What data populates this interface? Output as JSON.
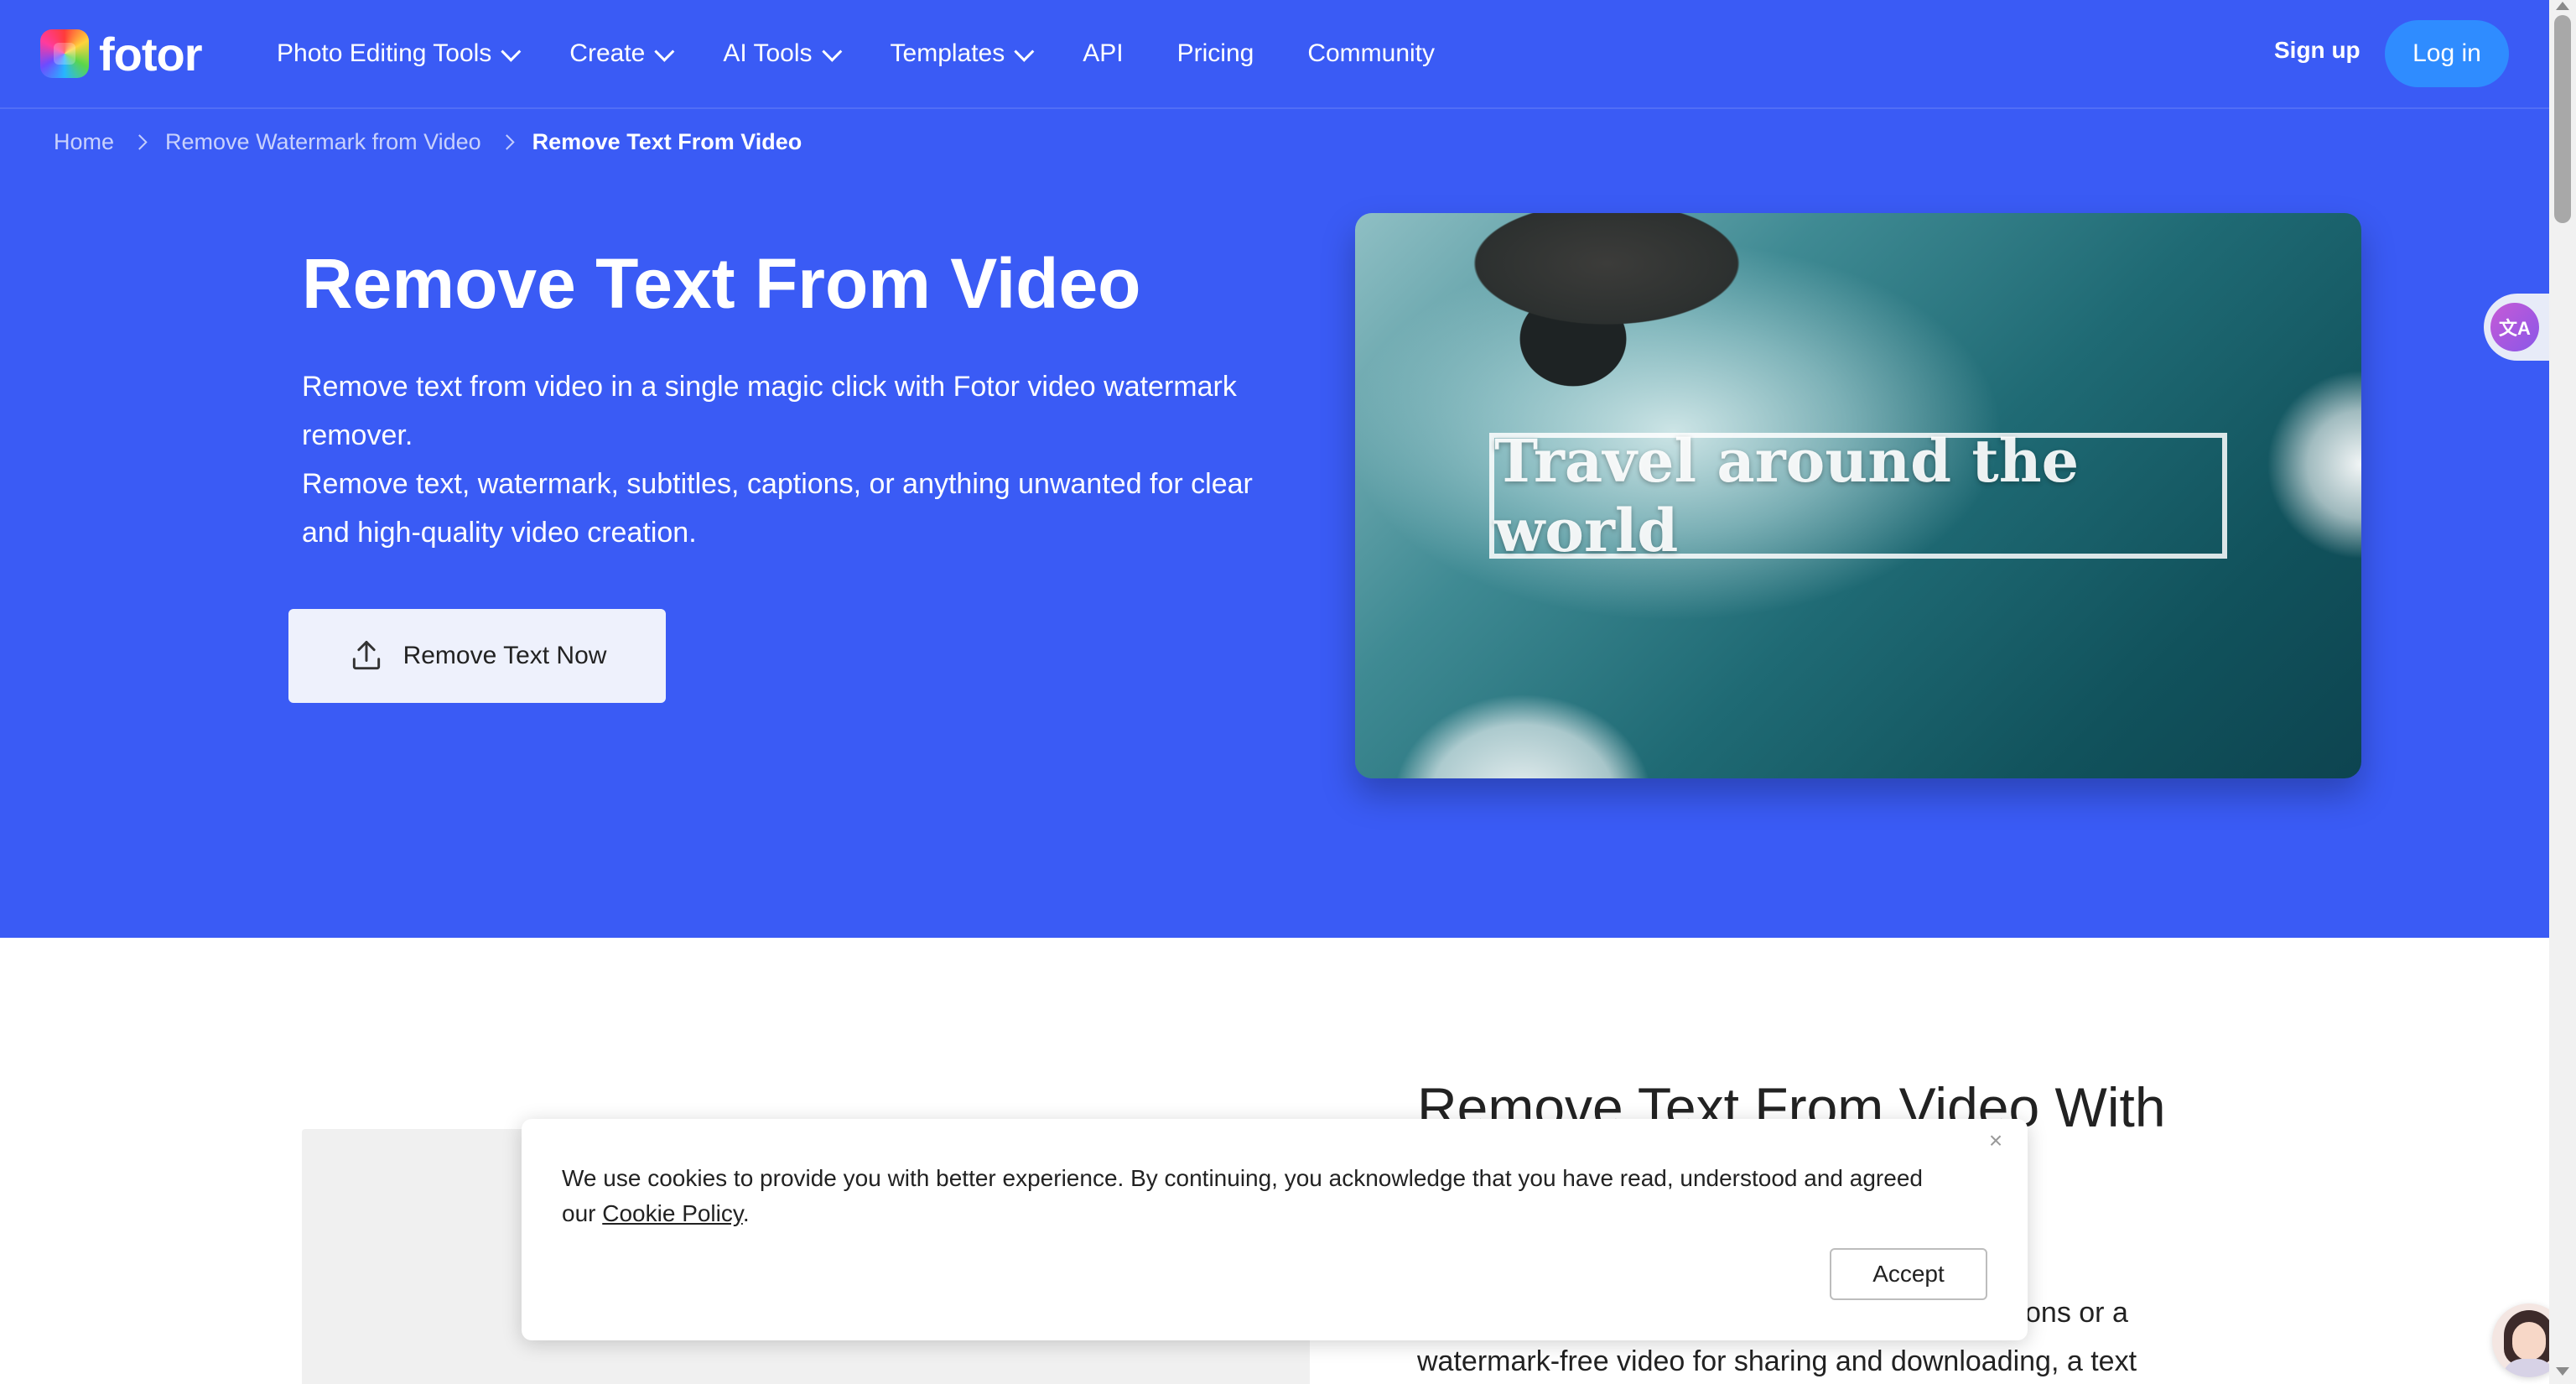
{
  "brand": {
    "name": "fotor"
  },
  "nav": {
    "items": [
      {
        "label": "Photo Editing Tools",
        "has_dropdown": true
      },
      {
        "label": "Create",
        "has_dropdown": true
      },
      {
        "label": "AI Tools",
        "has_dropdown": true
      },
      {
        "label": "Templates",
        "has_dropdown": true
      },
      {
        "label": "API",
        "has_dropdown": false
      },
      {
        "label": "Pricing",
        "has_dropdown": false
      },
      {
        "label": "Community",
        "has_dropdown": false
      }
    ],
    "signup_label": "Sign up",
    "login_label": "Log in"
  },
  "breadcrumb": {
    "items": [
      "Home",
      "Remove Watermark from Video"
    ],
    "current": "Remove Text From Video"
  },
  "hero": {
    "title": "Remove Text From Video",
    "desc_line1": "Remove text from video in a single magic click with Fotor video watermark remover.",
    "desc_line2": "Remove text, watermark, subtitles, captions, or anything unwanted for clear and high-quality video creation.",
    "cta_label": "Remove Text Now",
    "image_overlay_text": "Travel around the world",
    "background_color": "#3a5bf5"
  },
  "section": {
    "title": "Remove Text From Video With",
    "body_visible_end": "tions or a",
    "body_line2": "watermark-free video for sharing and downloading, a text"
  },
  "cookie": {
    "text_before_link": "We use cookies to provide you with better experience. By continuing, you acknowledge that you have read, understood and agreed our ",
    "link_label": "Cookie Policy",
    "text_after_link": ".",
    "accept_label": "Accept"
  },
  "icons": {
    "upload": "upload-icon",
    "translate": "translate-icon",
    "close": "close-icon",
    "chevron": "chevron-down-icon",
    "avatar": "support-avatar"
  },
  "colors": {
    "primary": "#3a5bf5",
    "login_button": "#2f8cff"
  }
}
